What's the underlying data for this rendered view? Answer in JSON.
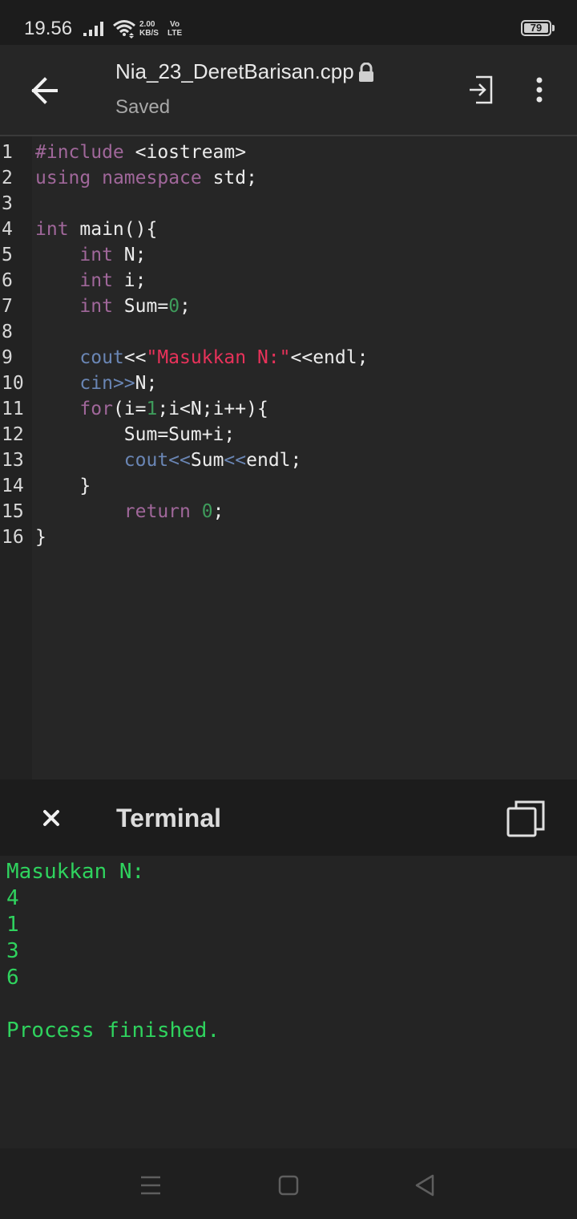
{
  "status_bar": {
    "time": "19.56",
    "speed_value": "2.00",
    "speed_unit": "KB/S",
    "net_top": "Vo",
    "net_bottom": "LTE",
    "battery": "79"
  },
  "app_bar": {
    "file_name": "Nia_23_DeretBarisan.cpp",
    "file_status": "Saved",
    "icons": {
      "back": "arrow-left-icon",
      "lock": "lock-icon",
      "exit": "exit-icon",
      "more": "more-vertical-icon"
    }
  },
  "editor": {
    "lines": [
      {
        "n": "1",
        "parts": [
          {
            "t": "#include",
            "c": "kw"
          },
          {
            "t": " <iostream>",
            "c": "pl"
          }
        ]
      },
      {
        "n": "2",
        "parts": [
          {
            "t": "using",
            "c": "kw"
          },
          {
            "t": " ",
            "c": "pl"
          },
          {
            "t": "namespace",
            "c": "kw"
          },
          {
            "t": " std;",
            "c": "pl"
          }
        ]
      },
      {
        "n": "3",
        "parts": []
      },
      {
        "n": "4",
        "parts": [
          {
            "t": "int",
            "c": "kw"
          },
          {
            "t": " main(){",
            "c": "pl"
          }
        ]
      },
      {
        "n": "5",
        "parts": [
          {
            "t": "    ",
            "c": "pl"
          },
          {
            "t": "int",
            "c": "kw"
          },
          {
            "t": " N;",
            "c": "pl"
          }
        ]
      },
      {
        "n": "6",
        "parts": [
          {
            "t": "    ",
            "c": "pl"
          },
          {
            "t": "int",
            "c": "kw"
          },
          {
            "t": " i;",
            "c": "pl"
          }
        ]
      },
      {
        "n": "7",
        "parts": [
          {
            "t": "    ",
            "c": "pl"
          },
          {
            "t": "int",
            "c": "kw"
          },
          {
            "t": " Sum=",
            "c": "pl"
          },
          {
            "t": "0",
            "c": "num"
          },
          {
            "t": ";",
            "c": "pl"
          }
        ]
      },
      {
        "n": "8",
        "parts": []
      },
      {
        "n": "9",
        "parts": [
          {
            "t": "    ",
            "c": "pl"
          },
          {
            "t": "cout",
            "c": "fn"
          },
          {
            "t": "<<",
            "c": "pl"
          },
          {
            "t": "\"Masukkan N:\"",
            "c": "str"
          },
          {
            "t": "<<endl;",
            "c": "pl"
          }
        ]
      },
      {
        "n": "10",
        "parts": [
          {
            "t": "    ",
            "c": "pl"
          },
          {
            "t": "cin",
            "c": "fn"
          },
          {
            "t": ">>",
            "c": "op"
          },
          {
            "t": "N;",
            "c": "pl"
          }
        ]
      },
      {
        "n": "11",
        "parts": [
          {
            "t": "    ",
            "c": "pl"
          },
          {
            "t": "for",
            "c": "kw"
          },
          {
            "t": "(i=",
            "c": "pl"
          },
          {
            "t": "1",
            "c": "num"
          },
          {
            "t": ";i<N;i++){",
            "c": "pl"
          }
        ]
      },
      {
        "n": "12",
        "parts": [
          {
            "t": "        Sum=Sum+i;",
            "c": "pl"
          }
        ]
      },
      {
        "n": "13",
        "parts": [
          {
            "t": "        ",
            "c": "pl"
          },
          {
            "t": "cout",
            "c": "fn"
          },
          {
            "t": "<<",
            "c": "op"
          },
          {
            "t": "Sum",
            "c": "pl"
          },
          {
            "t": "<<",
            "c": "op"
          },
          {
            "t": "endl;",
            "c": "pl"
          }
        ]
      },
      {
        "n": "14",
        "parts": [
          {
            "t": "    }",
            "c": "pl"
          }
        ]
      },
      {
        "n": "15",
        "parts": [
          {
            "t": "        ",
            "c": "pl"
          },
          {
            "t": "return",
            "c": "kw"
          },
          {
            "t": " ",
            "c": "pl"
          },
          {
            "t": "0",
            "c": "num"
          },
          {
            "t": ";",
            "c": "pl"
          }
        ]
      },
      {
        "n": "16",
        "parts": [
          {
            "t": "}",
            "c": "pl"
          }
        ]
      }
    ]
  },
  "terminal": {
    "title": "Terminal",
    "icons": {
      "close": "close-icon",
      "copy": "copy-icon"
    },
    "output": [
      "Masukkan N:",
      "4",
      "1",
      "3",
      "6",
      "",
      "Process finished."
    ]
  },
  "nav_bar": {
    "icons": {
      "menu": "menu-icon",
      "home": "home-icon",
      "back": "back-triangle-icon"
    }
  },
  "colors": {
    "keyword": "#a0679a",
    "function": "#6a86b5",
    "string": "#e8325a",
    "number": "#3e9b5b",
    "terminal_text": "#2fd35e"
  }
}
